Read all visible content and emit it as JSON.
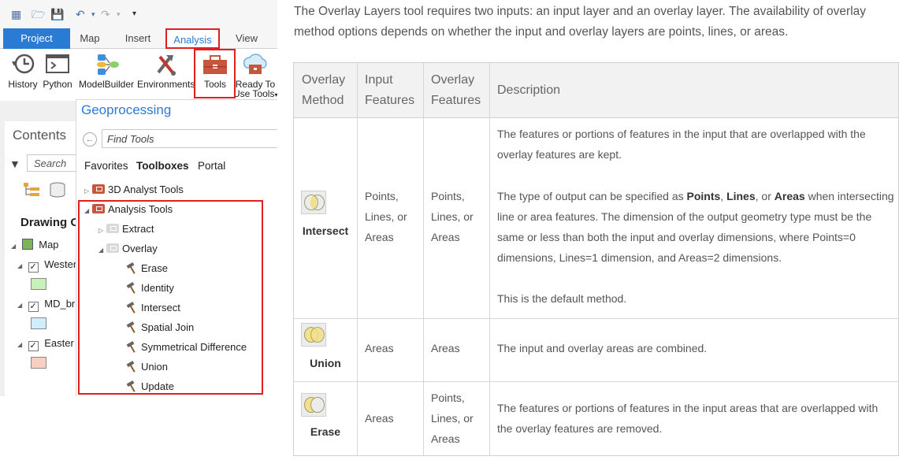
{
  "ribbon": {
    "tabs": [
      "Project",
      "Map",
      "Insert",
      "Analysis",
      "View"
    ],
    "buttons": [
      "History",
      "Python",
      "ModelBuilder",
      "Environments",
      "Tools",
      "Ready To",
      "Use Tools"
    ]
  },
  "contents": {
    "title": "Contents",
    "search_placeholder": "Search",
    "drawing_order": "Drawing O",
    "map": "Map",
    "layers": [
      "Wester",
      "MD_br",
      "Easter"
    ],
    "swatch_colors": [
      "#c9f0b8",
      "#cfeefa",
      "#f7d0c2"
    ]
  },
  "geoprocessing": {
    "title": "Geoprocessing",
    "find_placeholder": "Find Tools",
    "tabs": [
      "Favorites",
      "Toolboxes",
      "Portal"
    ],
    "toolboxes": [
      "3D Analyst Tools",
      "Analysis Tools"
    ],
    "toolsets": [
      "Extract",
      "Overlay"
    ],
    "tools": [
      "Erase",
      "Identity",
      "Intersect",
      "Spatial Join",
      "Symmetrical Difference",
      "Union",
      "Update"
    ]
  },
  "doc": {
    "intro": "The Overlay Layers tool requires two inputs: an input layer and an overlay layer. The availability of overlay method options depends on whether the input and overlay layers are points, lines, or areas.",
    "headers": [
      "Overlay Method",
      "Input Features",
      "Overlay Features",
      "Description"
    ],
    "rows": [
      {
        "method": "Intersect",
        "input": "Points, Lines, or Areas",
        "overlay": "Points, Lines, or Areas",
        "desc1": "The features or portions of features in the input that are overlapped with the overlay features are kept.",
        "desc2_pre": "The type of output can be specified as ",
        "desc2_points": "Points",
        "desc2_sep1": ", ",
        "desc2_lines": "Lines",
        "desc2_sep2": ", or ",
        "desc2_areas": "Areas",
        "desc2_post": " when intersecting line or area features. The dimension of the output geometry type must be the same or less than both the input and overlay dimensions, where Points=0 dimensions, Lines=1 dimension, and Areas=2 dimensions.",
        "desc3": "This is the default method."
      },
      {
        "method": "Union",
        "input": "Areas",
        "overlay": "Areas",
        "desc1": "The input and overlay areas are combined."
      },
      {
        "method": "Erase",
        "input": "Areas",
        "overlay": "Points, Lines, or Areas",
        "desc1": "The features or portions of features in the input areas that are overlapped with the overlay features are removed."
      }
    ]
  }
}
